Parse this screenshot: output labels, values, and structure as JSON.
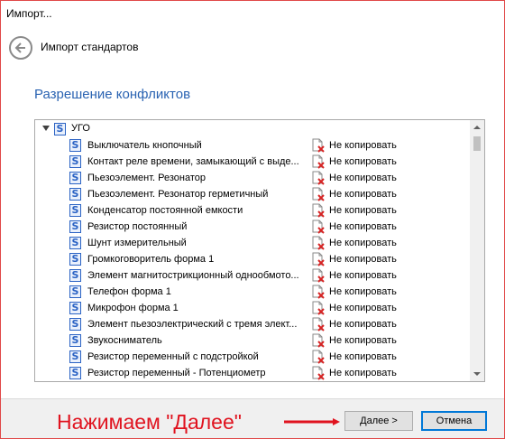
{
  "window": {
    "title": "Импорт..."
  },
  "header": {
    "title": "Импорт стандартов"
  },
  "section": {
    "title": "Разрешение конфликтов"
  },
  "tree": {
    "root_label": "УГО",
    "root_icon": "S",
    "items": [
      {
        "icon": "S",
        "name": "Выключатель кнопочный",
        "action": "Не копировать"
      },
      {
        "icon": "S",
        "name": "Контакт реле времени, замыкающий с выде...",
        "action": "Не копировать"
      },
      {
        "icon": "S",
        "name": "Пьезоэлемент. Резонатор",
        "action": "Не копировать"
      },
      {
        "icon": "S",
        "name": "Пьезоэлемент. Резонатор герметичный",
        "action": "Не копировать"
      },
      {
        "icon": "S",
        "name": "Конденсатор постоянной емкости",
        "action": "Не копировать"
      },
      {
        "icon": "S",
        "name": "Резистор постоянный",
        "action": "Не копировать"
      },
      {
        "icon": "S",
        "name": "Шунт измерительный",
        "action": "Не копировать"
      },
      {
        "icon": "S",
        "name": "Громкоговоритель форма 1",
        "action": "Не копировать"
      },
      {
        "icon": "S",
        "name": "Элемент магнитострикционный однообмото...",
        "action": "Не копировать"
      },
      {
        "icon": "S",
        "name": "Телефон форма 1",
        "action": "Не копировать"
      },
      {
        "icon": "S",
        "name": "Микрофон форма 1",
        "action": "Не копировать"
      },
      {
        "icon": "S",
        "name": "Элемент пьезоэлектрический с тремя элект...",
        "action": "Не копировать"
      },
      {
        "icon": "S",
        "name": "Звукосниматель",
        "action": "Не копировать"
      },
      {
        "icon": "S",
        "name": "Резистор переменный с подстройкой",
        "action": "Не копировать"
      },
      {
        "icon": "S",
        "name": "Резистор переменный - Потенциометр",
        "action": "Не копировать"
      }
    ]
  },
  "footer": {
    "annotation": "Нажимаем \"Далее\"",
    "next_label": "Далее >",
    "cancel_label": "Отмена"
  },
  "icons": {
    "back": "back-arrow-icon",
    "item": "s-standard-icon",
    "action": "do-not-copy-icon"
  },
  "colors": {
    "accent": "#2a63b2",
    "annotation": "#e0131f",
    "window_border": "#e04848"
  }
}
